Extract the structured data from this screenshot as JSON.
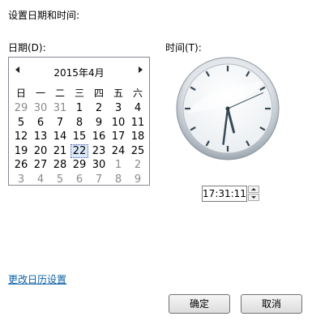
{
  "heading": "设置日期和时间:",
  "date_label": "日期(D):",
  "time_label": "时间(T):",
  "calendar": {
    "month_title": "2015年4月",
    "weekdays": [
      "日",
      "一",
      "二",
      "三",
      "四",
      "五",
      "六"
    ],
    "days": [
      {
        "d": "29",
        "other": true
      },
      {
        "d": "30",
        "other": true
      },
      {
        "d": "31",
        "other": true
      },
      {
        "d": "1"
      },
      {
        "d": "2"
      },
      {
        "d": "3"
      },
      {
        "d": "4"
      },
      {
        "d": "5"
      },
      {
        "d": "6"
      },
      {
        "d": "7"
      },
      {
        "d": "8"
      },
      {
        "d": "9"
      },
      {
        "d": "10"
      },
      {
        "d": "11"
      },
      {
        "d": "12"
      },
      {
        "d": "13"
      },
      {
        "d": "14"
      },
      {
        "d": "15"
      },
      {
        "d": "16"
      },
      {
        "d": "17"
      },
      {
        "d": "18"
      },
      {
        "d": "19"
      },
      {
        "d": "20"
      },
      {
        "d": "21"
      },
      {
        "d": "22",
        "selected": true
      },
      {
        "d": "23"
      },
      {
        "d": "24"
      },
      {
        "d": "25"
      },
      {
        "d": "26"
      },
      {
        "d": "27"
      },
      {
        "d": "28"
      },
      {
        "d": "29"
      },
      {
        "d": "30"
      },
      {
        "d": "1",
        "other": true
      },
      {
        "d": "2",
        "other": true
      },
      {
        "d": "3",
        "other": true
      },
      {
        "d": "4",
        "other": true
      },
      {
        "d": "5",
        "other": true
      },
      {
        "d": "6",
        "other": true
      },
      {
        "d": "7",
        "other": true
      },
      {
        "d": "8",
        "other": true
      },
      {
        "d": "9",
        "other": true
      }
    ]
  },
  "clock": {
    "hour": 17,
    "minute": 31,
    "second": 11
  },
  "time_value": "17:31:11",
  "change_calendar_link": "更改日历设置",
  "buttons": {
    "ok": "确定",
    "cancel": "取消"
  }
}
